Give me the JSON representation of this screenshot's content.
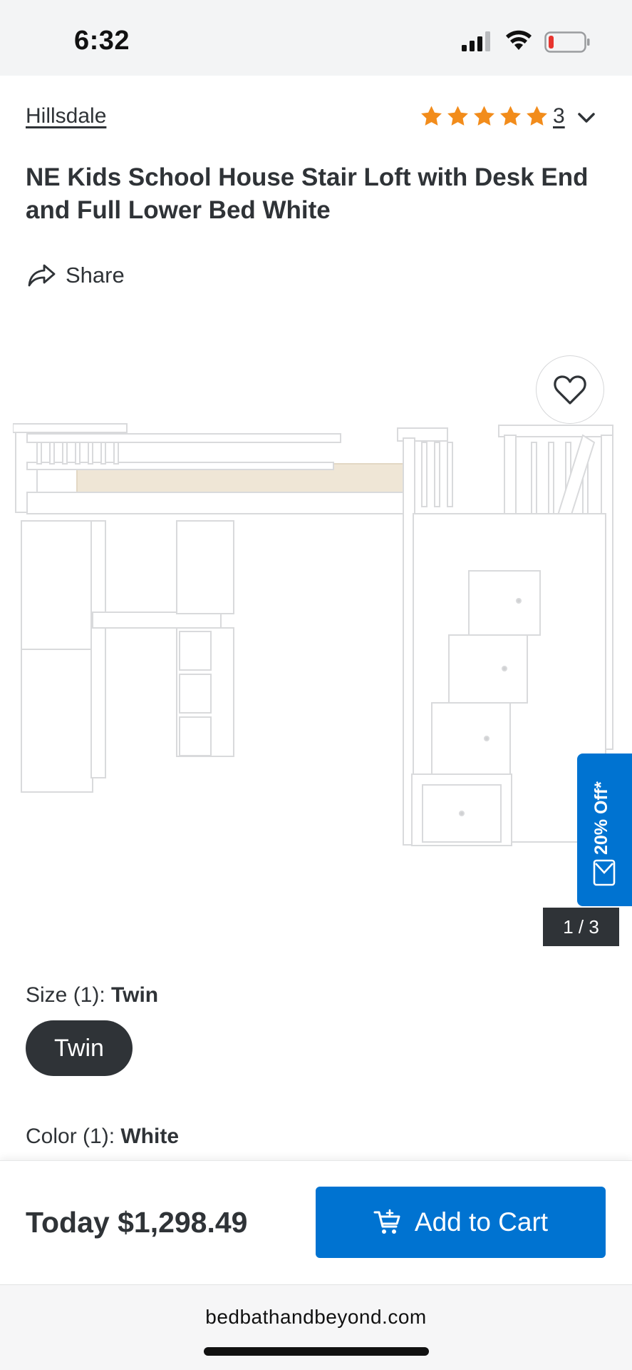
{
  "status_bar": {
    "time": "6:32",
    "signal_icon": "cellular-signal-icon",
    "wifi_icon": "wifi-icon",
    "battery_icon": "battery-low-icon"
  },
  "product": {
    "brand": "Hillsdale",
    "rating": {
      "stars": 5,
      "count": "3"
    },
    "title": "NE Kids School House Stair Loft with Desk End and Full Lower Bed White",
    "share_label": "Share"
  },
  "gallery": {
    "counter": "1 / 3",
    "image_icon": "loft-bed-image"
  },
  "promo": {
    "text": "20% Off*"
  },
  "options": {
    "size_prefix": "Size (1): ",
    "size_value": "Twin",
    "size_chip": "Twin",
    "color_prefix": "Color (1): ",
    "color_value": "White"
  },
  "cart": {
    "price": "Today $1,298.49",
    "button_label": "Add to Cart"
  },
  "browser": {
    "url": "bedbathandbeyond.com"
  },
  "colors": {
    "accent": "#0073d1",
    "star": "#f28c1b",
    "dark": "#2f3337"
  }
}
